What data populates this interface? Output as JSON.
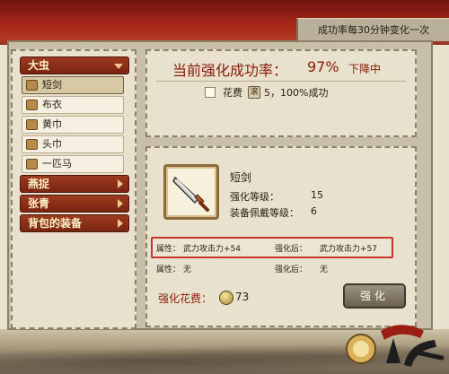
{
  "top_banner": "成功率每30分钟变化一次",
  "sidebar": {
    "categories": [
      {
        "label": "大虫",
        "open": true
      },
      {
        "label": "燕捉",
        "open": false
      },
      {
        "label": "张青",
        "open": false
      },
      {
        "label": "背包的装备",
        "open": false
      }
    ],
    "items": [
      {
        "label": "短剑",
        "selected": true
      },
      {
        "label": "布衣",
        "selected": false
      },
      {
        "label": "黄巾",
        "selected": false
      },
      {
        "label": "头巾",
        "selected": false
      },
      {
        "label": "一匹马",
        "selected": false
      }
    ]
  },
  "rate_panel": {
    "title": "当前强化成功率：",
    "value": "97%",
    "status": "下降中",
    "fee_label": "花费",
    "fee_icon": "滚",
    "fee_text": "5，100%成功"
  },
  "enhance_panel": {
    "item_name": "短剑",
    "icon": "broadsword-icon",
    "level_label": "强化等级：",
    "level_value": "15",
    "wear_label": "装备佩戴等级：",
    "wear_value": "6",
    "attr1_label": "属性：",
    "attr1_value": "武力攻击力+54",
    "after_label": "强化后：",
    "after_value": "武力攻击力+57",
    "attr2_label": "属性：",
    "attr2_value": "无",
    "after2_label": "强化后：",
    "after2_value": "无",
    "cost_label": "强化花费：",
    "cost_value": "73",
    "button_label": "强化"
  },
  "colors": {
    "accent_red": "#8b1a0a",
    "highlight_border": "#c9342a",
    "category_bg": "#7a2412"
  }
}
